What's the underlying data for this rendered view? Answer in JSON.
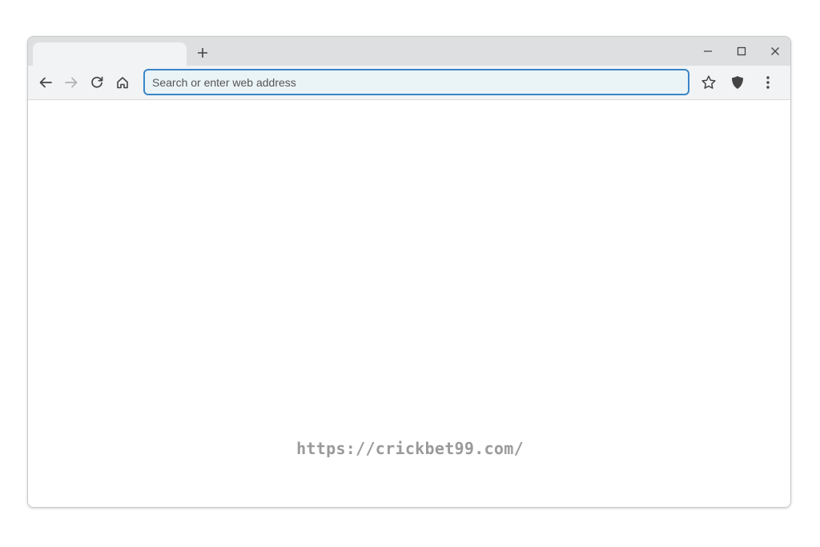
{
  "tab_strip": {
    "active_tab": {
      "title": ""
    },
    "new_tab_icon": "plus-icon",
    "window_controls": [
      "minimize-icon",
      "maximize-icon",
      "close-icon"
    ]
  },
  "toolbar": {
    "nav_icons": [
      "back-arrow-icon",
      "forward-arrow-icon",
      "reload-icon",
      "home-icon"
    ],
    "address_bar": {
      "placeholder": "Search or enter web address",
      "value": ""
    },
    "right_icons": [
      "star-icon",
      "shield-icon",
      "more-vertical-icon"
    ]
  },
  "page": {
    "watermark": "https://crickbet99.com/"
  },
  "colors": {
    "tab_strip_bg": "#dedfe1",
    "toolbar_bg": "#f2f3f5",
    "address_border": "#3a86c8",
    "address_bg": "#eaf4f6",
    "watermark": "#9a9a9a"
  }
}
